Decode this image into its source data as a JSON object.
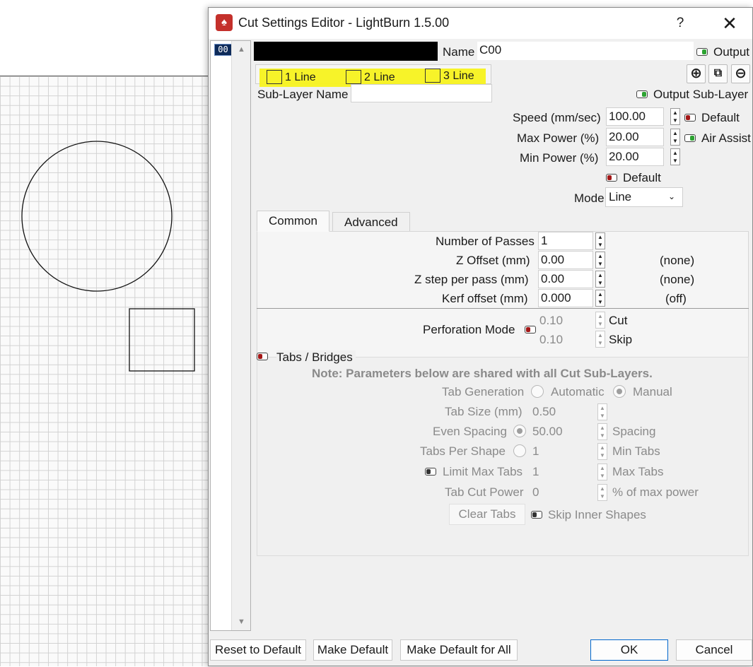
{
  "window": {
    "title": "Cut Settings Editor - LightBurn 1.5.00",
    "help": "?",
    "close": "✕"
  },
  "layer_list": {
    "chip": "00"
  },
  "header": {
    "name_label": "Name",
    "name_value": "C00",
    "output_label": "Output"
  },
  "sublayer_tabs": [
    {
      "label": "1 Line"
    },
    {
      "label": "2 Line"
    },
    {
      "label": "3 Line"
    }
  ],
  "sublayer": {
    "name_label": "Sub-Layer Name",
    "name_value": "",
    "output_label": "Output Sub-Layer"
  },
  "fields": {
    "speed_label": "Speed (mm/sec)",
    "speed_value": "100.00",
    "default_label": "Default",
    "maxpower_label": "Max Power (%)",
    "maxpower_value": "20.00",
    "air_assist_label": "Air Assist",
    "minpower_label": "Min Power (%)",
    "minpower_value": "20.00",
    "default2_label": "Default",
    "mode_label": "Mode",
    "mode_value": "Line"
  },
  "tabs": {
    "common": "Common",
    "advanced": "Advanced"
  },
  "common": {
    "passes_label": "Number of Passes",
    "passes_value": "1",
    "zoffset_label": "Z Offset (mm)",
    "zoffset_value": "0.00",
    "zoffset_note": "(none)",
    "zstep_label": "Z step per pass (mm)",
    "zstep_value": "0.00",
    "zstep_note": "(none)",
    "kerf_label": "Kerf offset (mm)",
    "kerf_value": "0.000",
    "kerf_note": "(off)",
    "perf_label": "Perforation Mode",
    "cut_value": "0.10",
    "cut_label": "Cut",
    "skip_value": "0.10",
    "skip_label": "Skip"
  },
  "tabs_bridges": {
    "title": "Tabs / Bridges",
    "note": "Note: Parameters below are shared with all Cut Sub-Layers.",
    "tab_gen_label": "Tab Generation",
    "automatic": "Automatic",
    "manual": "Manual",
    "tab_size_label": "Tab Size (mm)",
    "tab_size_value": "0.50",
    "even_spacing_label": "Even Spacing",
    "even_spacing_value": "50.00",
    "spacing_label": "Spacing",
    "tabs_per_shape_label": "Tabs Per Shape",
    "tabs_per_shape_value": "1",
    "min_tabs_label": "Min Tabs",
    "limit_max_label": "Limit Max Tabs",
    "limit_max_value": "1",
    "max_tabs_label": "Max Tabs",
    "tab_cut_power_label": "Tab Cut Power",
    "tab_cut_power_value": "0",
    "pct_label": "% of max power",
    "clear_tabs": "Clear Tabs",
    "skip_inner": "Skip Inner Shapes"
  },
  "footer": {
    "reset": "Reset to Default",
    "make_default": "Make Default",
    "make_default_all": "Make Default for All",
    "ok": "OK",
    "cancel": "Cancel"
  },
  "colors": {
    "highlight": "#f7f21e",
    "toggle_on": "#2da332",
    "toggle_off": "#a31616",
    "layer_chip": "#0d2a59"
  }
}
